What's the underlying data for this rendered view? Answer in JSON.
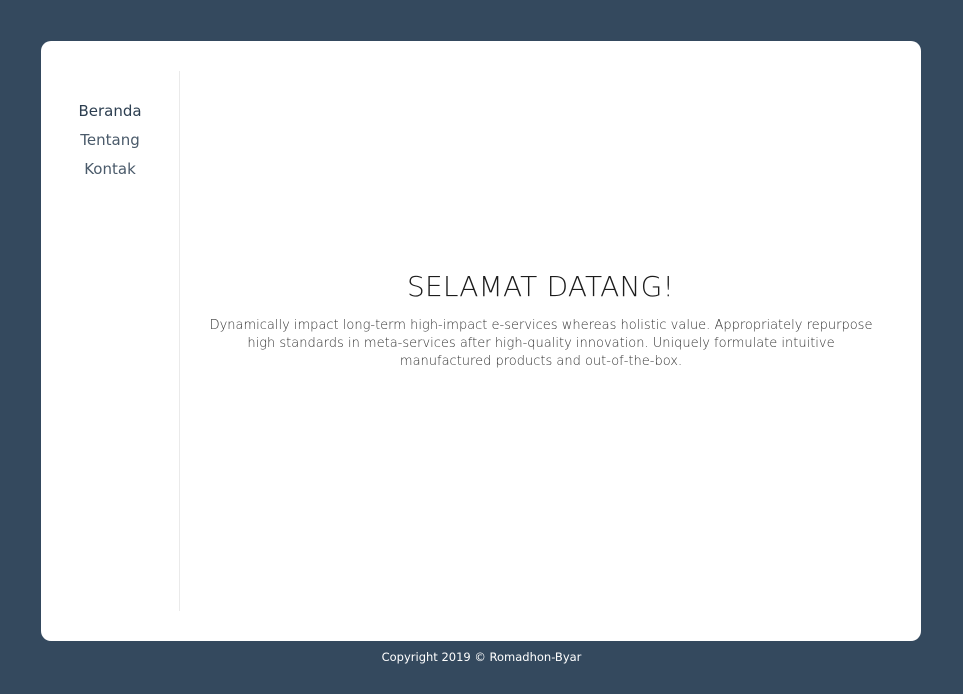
{
  "nav": {
    "items": [
      {
        "label": "Beranda",
        "active": true
      },
      {
        "label": "Tentang",
        "active": false
      },
      {
        "label": "Kontak",
        "active": false
      }
    ]
  },
  "main": {
    "title": "SELAMAT DATANG!",
    "description": "Dynamically impact long-term high-impact e-services whereas holistic value. Appropriately repurpose high standards in meta-services after high-quality innovation. Uniquely formulate intuitive manufactured products and out-of-the-box."
  },
  "footer": {
    "copyright": "Copyright 2019 © Romadhon-Byar"
  },
  "colors": {
    "background": "#34495e",
    "card": "#ffffff",
    "nav_active": "#2c3e50",
    "nav_text": "#4a5a6a"
  }
}
